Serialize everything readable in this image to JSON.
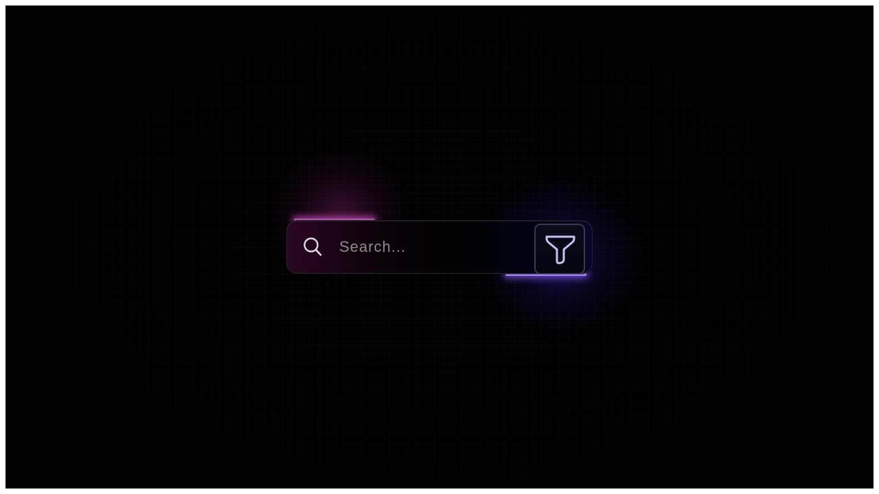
{
  "search": {
    "placeholder": "Search...",
    "value": "",
    "icon": "search-icon",
    "filter_icon": "filter-icon"
  },
  "colors": {
    "background": "#010101",
    "accent_pink": "#e07ad8",
    "accent_blue": "#a98cff"
  }
}
